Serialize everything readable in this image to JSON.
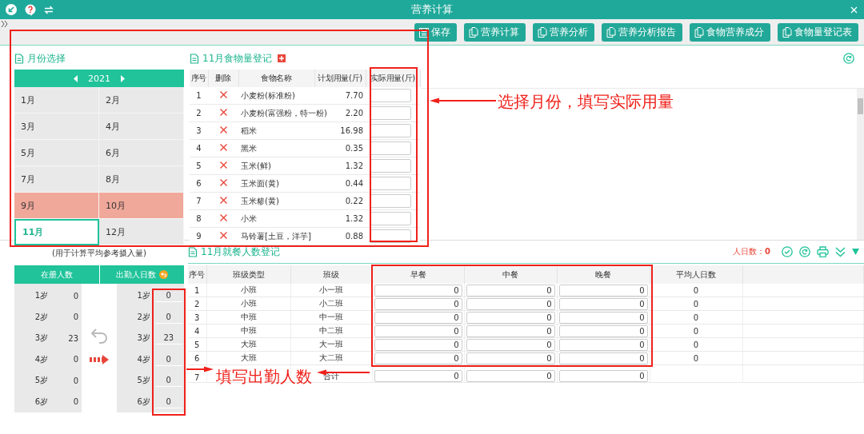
{
  "window": {
    "title": "营养计算"
  },
  "toolbar": {
    "buttons": [
      {
        "label": "保存",
        "kind": "save"
      },
      {
        "label": "营养计算",
        "kind": "copy"
      },
      {
        "label": "营养分析",
        "kind": "copy"
      },
      {
        "label": "营养分析报告",
        "kind": "copy"
      },
      {
        "label": "食物营养成分",
        "kind": "copy"
      },
      {
        "label": "食物量登记表",
        "kind": "copy"
      }
    ]
  },
  "month_panel": {
    "title": "月份选择",
    "year": "2021",
    "months": [
      {
        "label": "1月",
        "selected": false,
        "current": false
      },
      {
        "label": "2月",
        "selected": false,
        "current": false
      },
      {
        "label": "3月",
        "selected": false,
        "current": false
      },
      {
        "label": "4月",
        "selected": false,
        "current": false
      },
      {
        "label": "5月",
        "selected": false,
        "current": false
      },
      {
        "label": "6月",
        "selected": false,
        "current": false
      },
      {
        "label": "7月",
        "selected": false,
        "current": false
      },
      {
        "label": "8月",
        "selected": false,
        "current": false
      },
      {
        "label": "9月",
        "selected": true,
        "current": false
      },
      {
        "label": "10月",
        "selected": true,
        "current": false
      },
      {
        "label": "11月",
        "selected": false,
        "current": true
      },
      {
        "label": "12月",
        "selected": false,
        "current": false
      }
    ]
  },
  "food_register": {
    "title": "11月食物量登记",
    "columns": [
      "序号",
      "删除",
      "食物名称",
      "计划用量(斤)",
      "实际用量(斤)"
    ],
    "rows": [
      {
        "index": "1",
        "name": "小麦粉(标准粉)",
        "planned": "7.70"
      },
      {
        "index": "2",
        "name": "小麦粉(富强粉，特一粉)",
        "planned": "2.20"
      },
      {
        "index": "3",
        "name": "稻米",
        "planned": "16.98"
      },
      {
        "index": "4",
        "name": "黑米",
        "planned": "0.35"
      },
      {
        "index": "5",
        "name": "玉米(鲜)",
        "planned": "1.32"
      },
      {
        "index": "6",
        "name": "玉米面(黄)",
        "planned": "0.44"
      },
      {
        "index": "7",
        "name": "玉米糁(黄)",
        "planned": "0.22"
      },
      {
        "index": "8",
        "name": "小米",
        "planned": "1.32"
      },
      {
        "index": "9",
        "name": "马铃薯[土豆，洋芋]",
        "planned": "0.88"
      }
    ]
  },
  "attendance": {
    "note": "(用于计算平均参考摄入量)",
    "enrolled_header": "在册人数",
    "attended_header": "出勤人日数",
    "enrolled": [
      {
        "age": "1岁",
        "count": "0"
      },
      {
        "age": "2岁",
        "count": "0"
      },
      {
        "age": "3岁",
        "count": "23"
      },
      {
        "age": "4岁",
        "count": "0"
      },
      {
        "age": "5岁",
        "count": "0"
      },
      {
        "age": "6岁",
        "count": "0"
      }
    ],
    "attended": [
      {
        "age": "1岁",
        "count": "0"
      },
      {
        "age": "2岁",
        "count": "0"
      },
      {
        "age": "3岁",
        "count": "23"
      },
      {
        "age": "4岁",
        "count": "0"
      },
      {
        "age": "5岁",
        "count": "0"
      },
      {
        "age": "6岁",
        "count": "0"
      }
    ]
  },
  "meal_register": {
    "title": "11月就餐人数登记",
    "person_days_label": "人日数：",
    "person_days": "0",
    "columns": [
      "序号",
      "班级类型",
      "班级",
      "早餐",
      "中餐",
      "晚餐",
      "平均人日数"
    ],
    "rows": [
      {
        "index": "1",
        "class_type": "小班",
        "class_name": "小一班",
        "breakfast": "0",
        "lunch": "0",
        "dinner": "0",
        "average": "0"
      },
      {
        "index": "2",
        "class_type": "小班",
        "class_name": "小二班",
        "breakfast": "0",
        "lunch": "0",
        "dinner": "0",
        "average": "0"
      },
      {
        "index": "3",
        "class_type": "中班",
        "class_name": "中一班",
        "breakfast": "0",
        "lunch": "0",
        "dinner": "0",
        "average": "0"
      },
      {
        "index": "4",
        "class_type": "中班",
        "class_name": "中二班",
        "breakfast": "0",
        "lunch": "0",
        "dinner": "0",
        "average": "0"
      },
      {
        "index": "5",
        "class_type": "大班",
        "class_name": "大一班",
        "breakfast": "0",
        "lunch": "0",
        "dinner": "0",
        "average": "0"
      },
      {
        "index": "6",
        "class_type": "大班",
        "class_name": "大二班",
        "breakfast": "0",
        "lunch": "0",
        "dinner": "0",
        "average": "0"
      },
      {
        "index": "7",
        "class_name": "合计",
        "breakfast": "0",
        "lunch": "0",
        "dinner": "0"
      }
    ]
  },
  "annotations": [
    {
      "text": "选择月份，填写实际用量"
    },
    {
      "text": "填写出勤人数"
    }
  ]
}
